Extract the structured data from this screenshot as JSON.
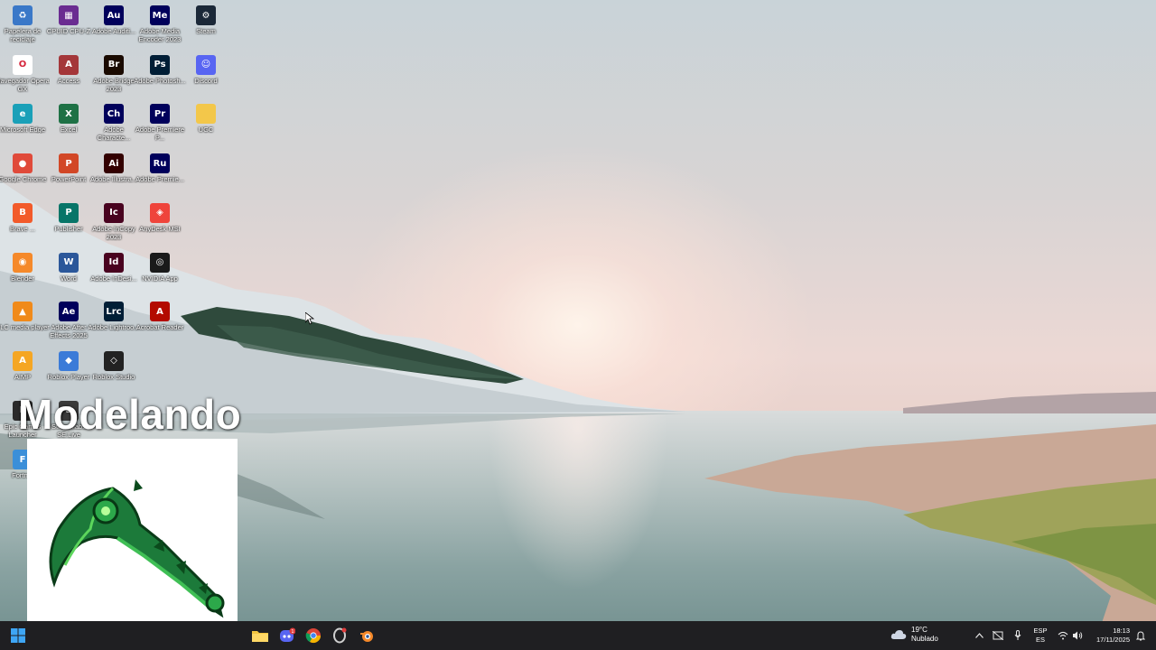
{
  "desktop": {
    "icons": [
      {
        "label": "Papelera de reciclaje",
        "icon": "recycle-bin-icon",
        "color": "#3a78c8",
        "glyph": "♻"
      },
      {
        "label": "Navegador Opera GX",
        "icon": "opera-gx-icon",
        "color": "#ffffff",
        "glyph": "O"
      },
      {
        "label": "Microsoft Edge",
        "icon": "edge-icon",
        "color": "#1aa0b8",
        "glyph": "e"
      },
      {
        "label": "Google Chrome",
        "icon": "chrome-icon",
        "color": "#e04a3a",
        "glyph": "●"
      },
      {
        "label": "Brave ...",
        "icon": "brave-icon",
        "color": "#f25a2a",
        "glyph": "B"
      },
      {
        "label": "Blender",
        "icon": "blender-icon",
        "color": "#f5892a",
        "glyph": "◉"
      },
      {
        "label": "VLC media player",
        "icon": "vlc-icon",
        "color": "#f08a1a",
        "glyph": "▲"
      },
      {
        "label": "AIMP",
        "icon": "aimp-icon",
        "color": "#f5a623",
        "glyph": "A"
      },
      {
        "label": "Epic Games Launcher",
        "icon": "epic-games-icon",
        "color": "#2a2a2a",
        "glyph": "E"
      },
      {
        "label": "Fortn...",
        "icon": "fortnite-icon",
        "color": "#3b8fd9",
        "glyph": "F"
      },
      {
        "label": "CPUID CPU-Z",
        "icon": "cpu-z-icon",
        "color": "#6a2c91",
        "glyph": "▦"
      },
      {
        "label": "Access",
        "icon": "access-icon",
        "color": "#a4373a",
        "glyph": "A"
      },
      {
        "label": "Excel",
        "icon": "excel-icon",
        "color": "#1e7145",
        "glyph": "X"
      },
      {
        "label": "PowerPoint",
        "icon": "powerpoint-icon",
        "color": "#d24726",
        "glyph": "P"
      },
      {
        "label": "Publisher",
        "icon": "publisher-icon",
        "color": "#077568",
        "glyph": "P"
      },
      {
        "label": "Word",
        "icon": "word-icon",
        "color": "#2b579a",
        "glyph": "W"
      },
      {
        "label": "Adobe After Effects 2025",
        "icon": "after-effects-icon",
        "color": "#00005b",
        "glyph": "Ae"
      },
      {
        "label": "Roblox Player",
        "icon": "roblox-player-icon",
        "color": "#3b7bd8",
        "glyph": "◆"
      },
      {
        "label": "Streamlabs SE.Live",
        "icon": "se-live-icon",
        "color": "#3a3a3a",
        "glyph": "S"
      },
      {
        "label": "Adobe Auditi...",
        "icon": "audition-icon",
        "color": "#00005b",
        "glyph": "Au"
      },
      {
        "label": "Adobe Bridge 2023",
        "icon": "bridge-icon",
        "color": "#1a0a00",
        "glyph": "Br"
      },
      {
        "label": "Adobe Characte...",
        "icon": "character-animator-icon",
        "color": "#00005b",
        "glyph": "Ch"
      },
      {
        "label": "Adobe Illustra...",
        "icon": "illustrator-icon",
        "color": "#330000",
        "glyph": "Ai"
      },
      {
        "label": "Adobe InCopy 2023",
        "icon": "incopy-icon",
        "color": "#49021f",
        "glyph": "Ic"
      },
      {
        "label": "Adobe InDesi...",
        "icon": "indesign-icon",
        "color": "#49021f",
        "glyph": "Id"
      },
      {
        "label": "Adobe Lightroo...",
        "icon": "lightroom-classic-icon",
        "color": "#001e36",
        "glyph": "Lrc"
      },
      {
        "label": "Roblox Studio",
        "icon": "roblox-studio-icon",
        "color": "#222222",
        "glyph": "◇"
      },
      {
        "label": "Adobe Media Encoder 2023",
        "icon": "media-encoder-icon",
        "color": "#00005b",
        "glyph": "Me"
      },
      {
        "label": "Adobe Photosh...",
        "icon": "photoshop-icon",
        "color": "#001e36",
        "glyph": "Ps"
      },
      {
        "label": "Adobe Premiere P...",
        "icon": "premiere-pro-icon",
        "color": "#00005b",
        "glyph": "Pr"
      },
      {
        "label": "Adobe Premie...",
        "icon": "premiere-rush-icon",
        "color": "#00005b",
        "glyph": "Ru"
      },
      {
        "label": "AnyDesk MSI",
        "icon": "anydesk-icon",
        "color": "#ef443b",
        "glyph": "◈"
      },
      {
        "label": "NVIDIA App",
        "icon": "nvidia-icon",
        "color": "#1a1a1a",
        "glyph": "◎"
      },
      {
        "label": "Acrobat Reader",
        "icon": "acrobat-icon",
        "color": "#b30b00",
        "glyph": "A"
      },
      {
        "label": "Steam",
        "icon": "steam-icon",
        "color": "#1b2838",
        "glyph": "⚙"
      },
      {
        "label": "Discord",
        "icon": "discord-icon",
        "color": "#5865f2",
        "glyph": "☺"
      },
      {
        "label": "UGC",
        "icon": "folder-icon",
        "color": "#f3c74a",
        "glyph": ""
      }
    ]
  },
  "overlay": {
    "title": "Modelando"
  },
  "taskbar": {
    "weather_temp": "19°C",
    "weather_desc": "Nublado",
    "lang_code": "ESP",
    "lang_region": "ES",
    "time": "18:13",
    "date": "17/11/2025",
    "discord_badge": "1"
  }
}
